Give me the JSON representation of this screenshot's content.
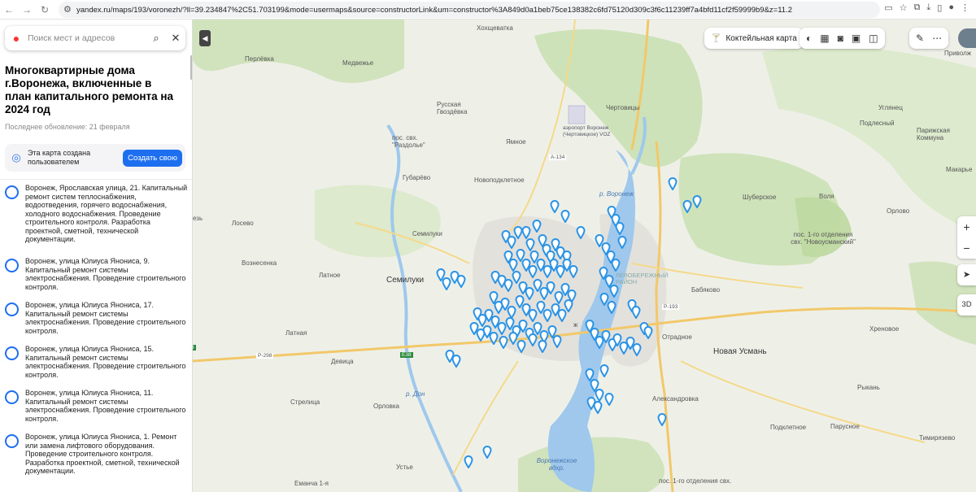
{
  "browser": {
    "url": "yandex.ru/maps/193/voronezh/?ll=39.234847%2C51.703199&mode=usermaps&source=constructorLink&um=constructor%3A849d0a1beb75ce138382c6fd75120d309c3f6c11239ff7a4bfd11cf2f59999b9&z=11.2"
  },
  "panel": {
    "search_placeholder": "Поиск мест и адресов",
    "title": "Многоквартирные дома г.Воронежа, включенные в план капитального ремонта на 2024 год",
    "updated": "Последнее обновление: 21 февраля",
    "created_text": "Эта карта создана пользователем",
    "create_button": "Создать свою",
    "items": [
      {
        "text": "Воронеж, Ярославская улица, 21. Капитальный ремонт систем теплоснабжения, водоотведения, горячего водоснабжения, холодного водоснабжения. Проведение строительного контроля. Разработка проектной, сметной, технической документации."
      },
      {
        "text": "Воронеж, улица Юлиуса Янониса, 9. Капитальный ремонт системы электроснабжения. Проведение строительного контроля."
      },
      {
        "text": "Воронеж, улица Юлиуса Янониса, 17. Капитальный ремонт системы электроснабжения. Проведение строительного контроля."
      },
      {
        "text": "Воронеж, улица Юлиуса Янониса, 15. Капитальный ремонт системы электроснабжения. Проведение строительного контроля."
      },
      {
        "text": "Воронеж, улица Юлиуса Янониса, 11. Капитальный ремонт системы электроснабжения. Проведение строительного контроля."
      },
      {
        "text": "Воронеж, улица Юлиуса Янониса, 1. Ремонт или замена лифтового оборудования. Проведение строительного контроля. Разработка проектной, сметной, технической документации."
      }
    ]
  },
  "map_controls": {
    "layer_label": "Коктейльная карта",
    "three_d": "3D",
    "zoom_in": "+",
    "zoom_out": "−"
  },
  "map_labels": {
    "khoshchevatka": "Хохщеватка",
    "perlevka": "Перлёвка",
    "medvezhye": "Медвежье",
    "russkaya_gvozdevka": "Русская Гвоздёвка",
    "airport": "аэропорт Воронеж (Чертовицкое) VOZ",
    "chertovitsy": "Чертовицы",
    "uglyanets": "Углянец",
    "podlesny": "Подлесный",
    "parizhskaya": "Парижская Коммуна",
    "rajdolye": "пос. свх. \"Раздолье\"",
    "yamnoe": "Ямное",
    "gubarevo": "Губарёво",
    "novopodkletnoe": "Новоподклетное",
    "makarye": "Макарье",
    "shuberskoe": "Шуберское",
    "volya": "Воля",
    "orlovo": "Орлово",
    "losevo": "Лосево",
    "semiluki_v": "Семилуки",
    "novosmanskiy": "пос. 1-го отделения свх. \"Новоусманский\"",
    "voznesenka": "Вознесенка",
    "latnoe": "Латное",
    "semiluki": "Семилуки",
    "babyakovo": "Бабяково",
    "levoberezhny": "ЛЕВОБЕРЕЖНЫЙ РАЙОН",
    "otradnoe": "Отрадное",
    "latnaya": "Латная",
    "khrenovoe": "Хреновое",
    "novaya_usman": "Новая Усмань",
    "devitsa": "Девица",
    "strelitsa": "Стрелица",
    "aleksandrovka": "Александровка",
    "orlovka": "Орловка",
    "rykan": "Рыкань",
    "podkletnoe": "Подклетное",
    "parusnoe": "Парусное",
    "timiryazevo": "Тимирязево",
    "ustye": "Устье",
    "voronezh_res": "Воронежское вдхр.",
    "emanya": "Еманча 1-я",
    "podkl2": "пос. 1-го отделения свх.",
    "privolzh": "Приволж",
    "voronezh_river": "р. Воронеж",
    "don": "р. Дон",
    "road_a134": "А-134",
    "road_p193": "Р-193",
    "road_p298": "Р-298",
    "road_e38": "Е38",
    "vzh": "ж",
    "ez": "езь"
  },
  "colors": {
    "accent": "#1e6ff0",
    "pin": "#2a93e6",
    "water": "#9fc8ec",
    "forest": "#c9e0b2",
    "city": "#e3e1dc"
  }
}
